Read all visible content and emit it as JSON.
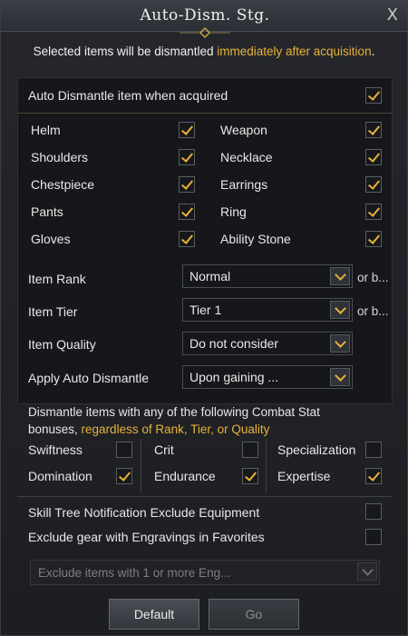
{
  "window": {
    "title": "Auto-Dism. Stg.",
    "close_glyph": "X",
    "info_prefix": "Selected items will be dismantled ",
    "info_highlight": "immediately after acquisition",
    "info_suffix": "."
  },
  "auto_dismantle": {
    "label": "Auto Dismantle item when acquired",
    "checked": true
  },
  "equipment": [
    {
      "label": "Helm",
      "checked": true
    },
    {
      "label": "Weapon",
      "checked": true
    },
    {
      "label": "Shoulders",
      "checked": true
    },
    {
      "label": "Necklace",
      "checked": true
    },
    {
      "label": "Chestpiece",
      "checked": true
    },
    {
      "label": "Earrings",
      "checked": true
    },
    {
      "label": "Pants",
      "checked": true
    },
    {
      "label": "Ring",
      "checked": true
    },
    {
      "label": "Gloves",
      "checked": true
    },
    {
      "label": "Ability Stone",
      "checked": true
    }
  ],
  "filters": [
    {
      "label": "Item Rank",
      "value": "Normal",
      "suffix": "or b..."
    },
    {
      "label": "Item Tier",
      "value": "Tier 1",
      "suffix": "or b..."
    },
    {
      "label": "Item Quality",
      "value": "Do not consider",
      "suffix": ""
    },
    {
      "label": "Apply Auto Dismantle",
      "value": "Upon gaining ...",
      "suffix": ""
    }
  ],
  "combat": {
    "line1": "Dismantle items with any of the following Combat Stat",
    "line2_prefix": "bonuses, ",
    "line2_highlight": "regardless of Rank, Tier, or Quality",
    "stats": [
      {
        "label": "Swiftness",
        "checked": false
      },
      {
        "label": "Crit",
        "checked": false
      },
      {
        "label": "Specialization",
        "checked": false
      },
      {
        "label": "Domination",
        "checked": true
      },
      {
        "label": "Endurance",
        "checked": true
      },
      {
        "label": "Expertise",
        "checked": true
      }
    ]
  },
  "options": [
    {
      "label": "Skill Tree Notification Exclude Equipment",
      "checked": false
    },
    {
      "label": "Exclude gear with Engravings in Favorites",
      "checked": false
    }
  ],
  "engraving_dropdown": {
    "value": "Exclude items with 1 or more Eng..."
  },
  "buttons": {
    "default": "Default",
    "go": "Go"
  },
  "colors": {
    "accent": "#e8b23a",
    "panel": "#15171a",
    "text": "#e8e8e8"
  }
}
